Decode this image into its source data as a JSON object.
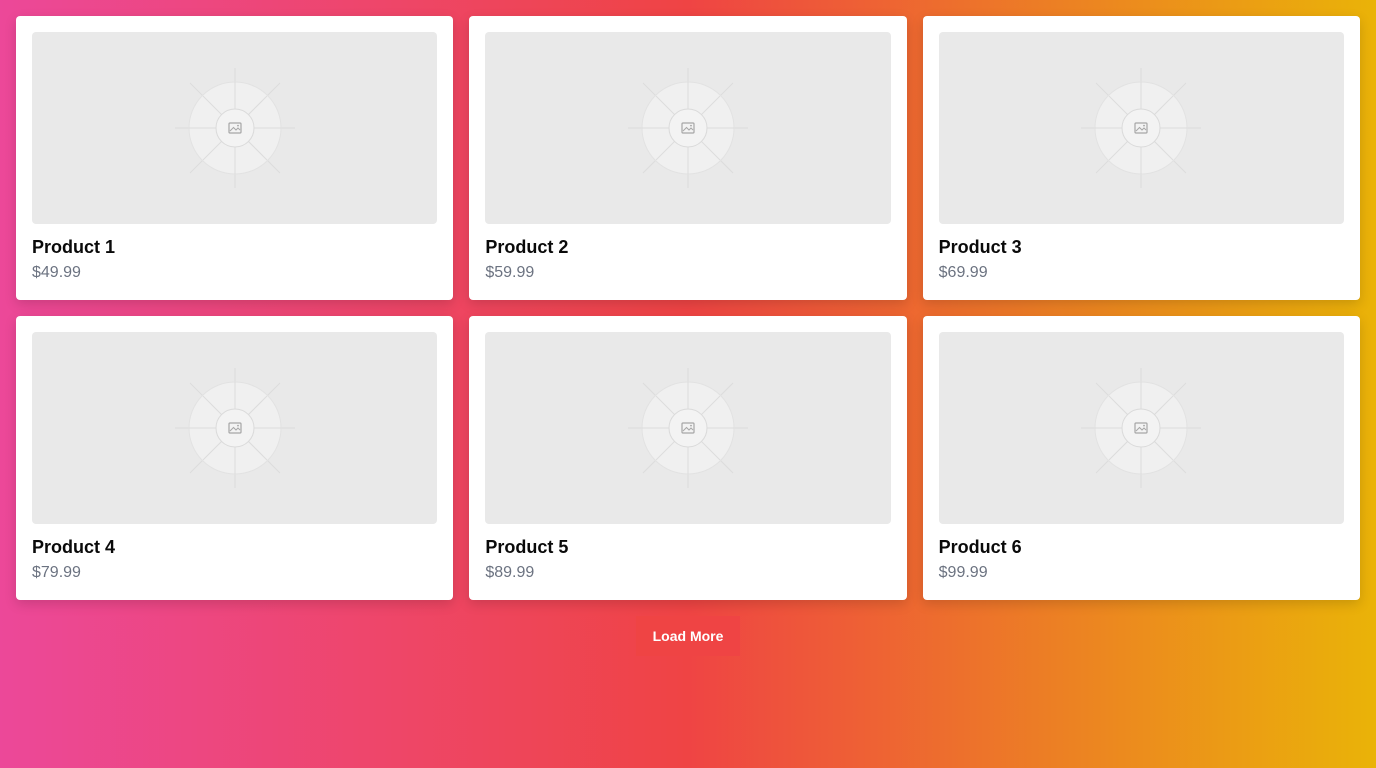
{
  "products": [
    {
      "name": "Product 1",
      "price": "$49.99",
      "icon": "image-placeholder-icon"
    },
    {
      "name": "Product 2",
      "price": "$59.99",
      "icon": "image-placeholder-icon"
    },
    {
      "name": "Product 3",
      "price": "$69.99",
      "icon": "image-placeholder-icon"
    },
    {
      "name": "Product 4",
      "price": "$79.99",
      "icon": "image-placeholder-icon"
    },
    {
      "name": "Product 5",
      "price": "$89.99",
      "icon": "image-placeholder-icon"
    },
    {
      "name": "Product 6",
      "price": "$99.99",
      "icon": "image-placeholder-icon"
    }
  ],
  "load_more": {
    "label": "Load More"
  },
  "colors": {
    "background_gradient": [
      "#ec4899",
      "#ef4444",
      "#eab308"
    ],
    "button": "#ef4444",
    "card": "#ffffff",
    "thumbnail": "#e9e9e9",
    "price_text": "#6b7280"
  }
}
